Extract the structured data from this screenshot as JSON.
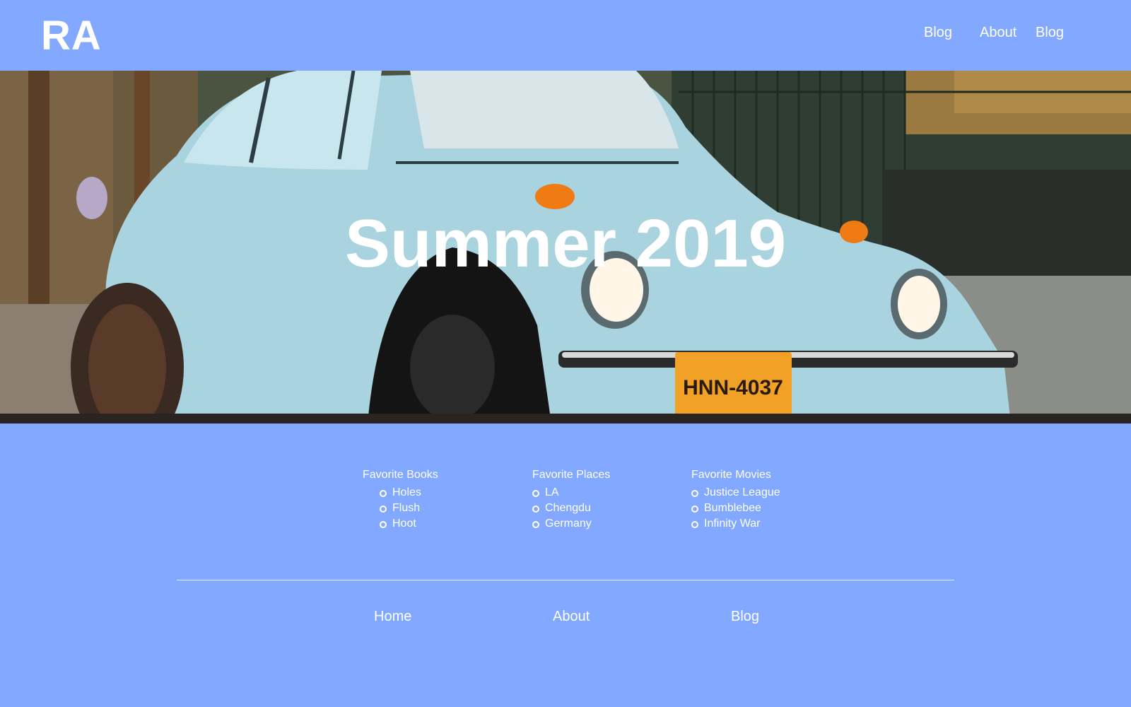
{
  "header": {
    "logo": "RA",
    "nav": [
      "Blog",
      "About",
      "Blog"
    ]
  },
  "hero": {
    "title": "Summer 2019",
    "plate_text": "HNN-4037"
  },
  "lists": {
    "books": {
      "title": "Favorite Books",
      "items": [
        "Holes",
        "Flush",
        "Hoot"
      ]
    },
    "places": {
      "title": "Favorite Places",
      "items": [
        "LA",
        "Chengdu",
        "Germany"
      ]
    },
    "movies": {
      "title": "Favorite Movies",
      "items": [
        "Justice League",
        "Bumblebee",
        "Infinity War"
      ]
    }
  },
  "footer": {
    "links": [
      "Home",
      "About",
      "Blog"
    ]
  },
  "colors": {
    "background": "#82a8ff",
    "text": "#ffffff",
    "car": "#a9d3df"
  }
}
